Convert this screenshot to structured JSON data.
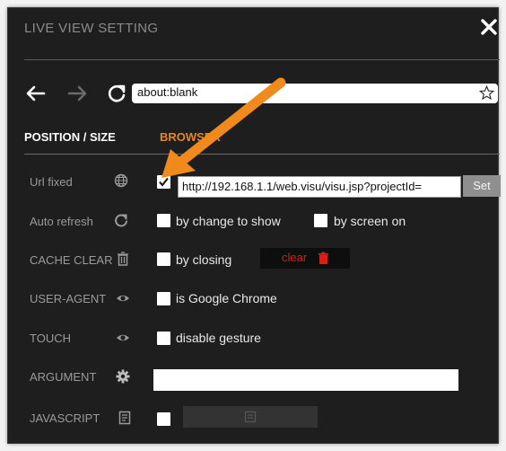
{
  "window": {
    "title": "LIVE VIEW SETTING",
    "close_icon": "close-icon"
  },
  "browser_bar": {
    "url": "about:blank",
    "icons": [
      "back-arrow-icon",
      "forward-arrow-icon",
      "reload-icon",
      "star-icon"
    ]
  },
  "tabs": [
    {
      "label": "POSITION / SIZE",
      "active": false
    },
    {
      "label": "BROWSER",
      "active": true
    }
  ],
  "settings": {
    "url_fixed": {
      "label": "Url fixed",
      "icon": "globe-icon",
      "checked": true,
      "value": "http://192.168.1.1/web.visu/visu.jsp?projectId=",
      "set_label": "Set"
    },
    "auto_refresh": {
      "label": "Auto refresh",
      "icon": "refresh-icon",
      "option1": "by change to show",
      "option2": "by screen on"
    },
    "cache_clear": {
      "label": "CACHE CLEAR",
      "icon": "trash-icon",
      "option": "by closing",
      "clear_label": "clear"
    },
    "user_agent": {
      "label": "USER-AGENT",
      "icon": "eye-icon",
      "option": "is Google Chrome"
    },
    "touch": {
      "label": "TOUCH",
      "icon": "eye-icon",
      "option": "disable gesture"
    },
    "argument": {
      "label": "ARGUMENT",
      "icon": "gear-icon",
      "value": ""
    },
    "javascript": {
      "label": "JAVASCRIPT",
      "icon": "document-icon"
    }
  },
  "colors": {
    "background": "#1e1e1e",
    "accent": "#e8871e",
    "clear_text": "#d91c1c",
    "annotation_arrow": "#f08a1c"
  }
}
